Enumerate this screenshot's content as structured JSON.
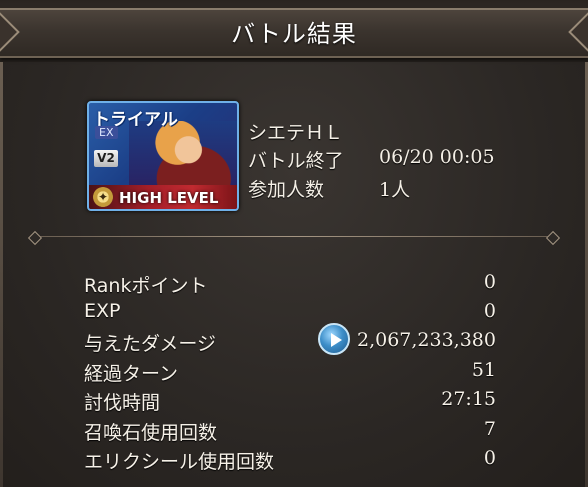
{
  "header": {
    "title": "バトル結果"
  },
  "quest": {
    "banner": {
      "trial_label": "トライアル",
      "ex_label": "EX",
      "version_label": "V2",
      "difficulty_label": "HIGH LEVEL"
    },
    "name": "シエテＨＬ",
    "end_label": "バトル終了",
    "end_value": "06/20 00:05",
    "participants_label": "参加人数",
    "participants_value": "1人"
  },
  "stats": [
    {
      "label": "Rankポイント",
      "value": "0"
    },
    {
      "label": "EXP",
      "value": "0"
    },
    {
      "label": "与えたダメージ",
      "value": "2,067,233,380",
      "has_button": true
    },
    {
      "label": "経過ターン",
      "value": "51"
    },
    {
      "label": "討伐時間",
      "value": "27:15"
    },
    {
      "label": "召喚石使用回数",
      "value": "7"
    },
    {
      "label": "エリクシール使用回数",
      "value": "0"
    }
  ],
  "icons": {
    "damage_detail": "play-icon",
    "difficulty": "hl-emblem-icon"
  },
  "colors": {
    "background": "#2d2926",
    "banner": "#1b3e86",
    "high_level": "#a41e28",
    "play_button": "#3e8fc9"
  }
}
